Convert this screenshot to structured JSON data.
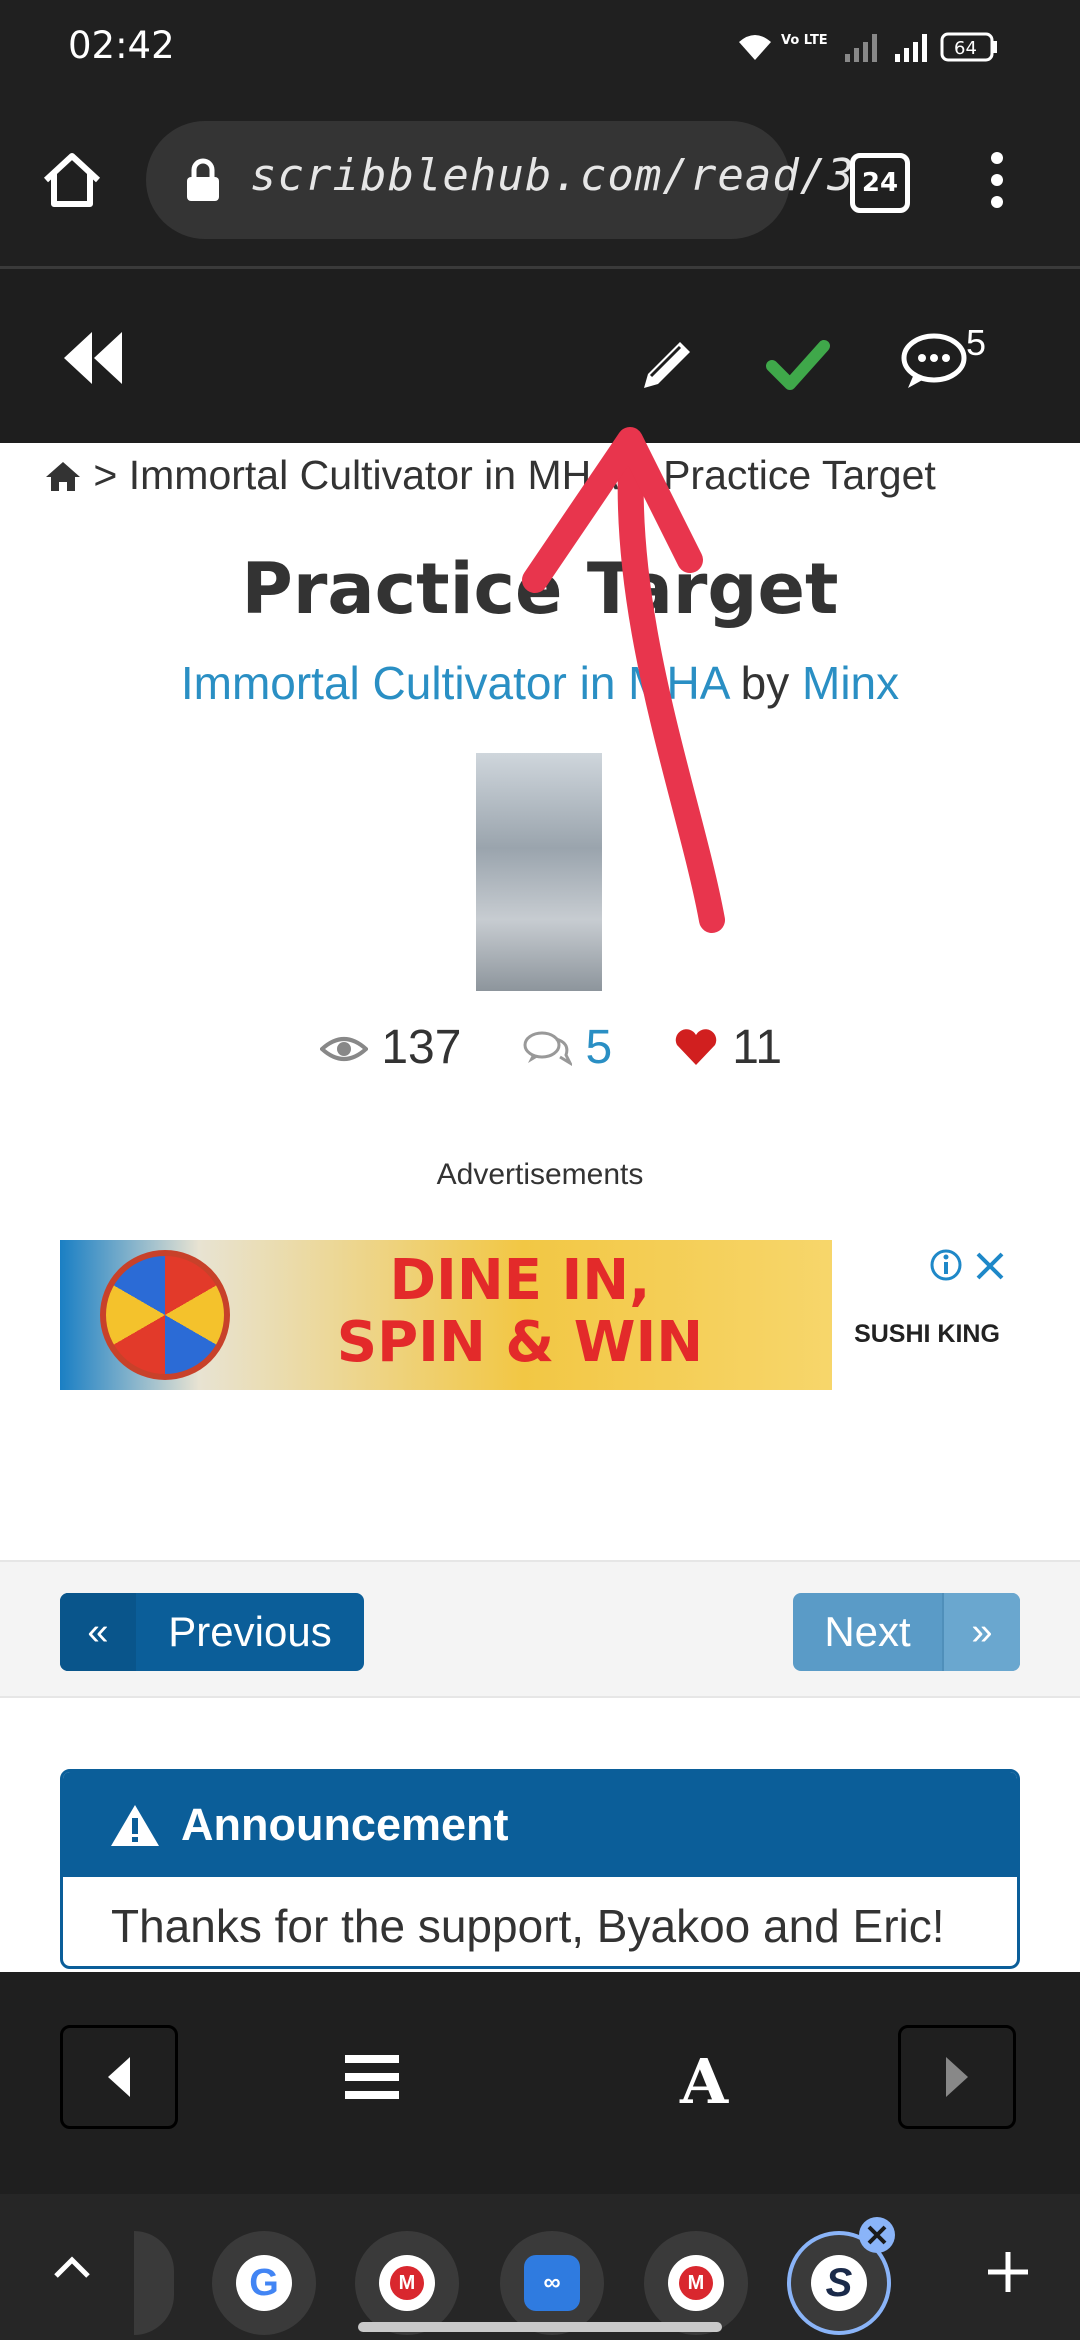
{
  "status_bar": {
    "time": "02:42",
    "network_label": "Vo LTE",
    "battery": "64"
  },
  "browser": {
    "url": "scribblehub.com/read/3",
    "tab_count": "24"
  },
  "site_nav": {
    "comment_count": "5"
  },
  "breadcrumb": {
    "series": "Immortal Cultivator in MHA",
    "chapter": "Practice Target"
  },
  "chapter": {
    "title": "Practice Target",
    "series_link": "Immortal Cultivator in MHA",
    "by": "by",
    "author": "Minx"
  },
  "stats": {
    "views": "137",
    "comments": "5",
    "favorites": "11"
  },
  "ads": {
    "label": "Advertisements",
    "headline_line1": "DINE IN,",
    "headline_line2": "SPIN & WIN",
    "brand": "SUSHI KING"
  },
  "pagination": {
    "previous_label": "Previous",
    "next_label": "Next",
    "prev_chev": "«",
    "next_chev": "»"
  },
  "announcement": {
    "title": "Announcement",
    "body": "Thanks for the support, Byakoo and Eric!"
  },
  "colors": {
    "link": "#2a8fc4",
    "primary_button": "#0b5e99",
    "next_button": "#5a9bc7",
    "heart": "#d11f1f",
    "check": "#3fa84a",
    "annotation_arrow": "#e8354d"
  }
}
